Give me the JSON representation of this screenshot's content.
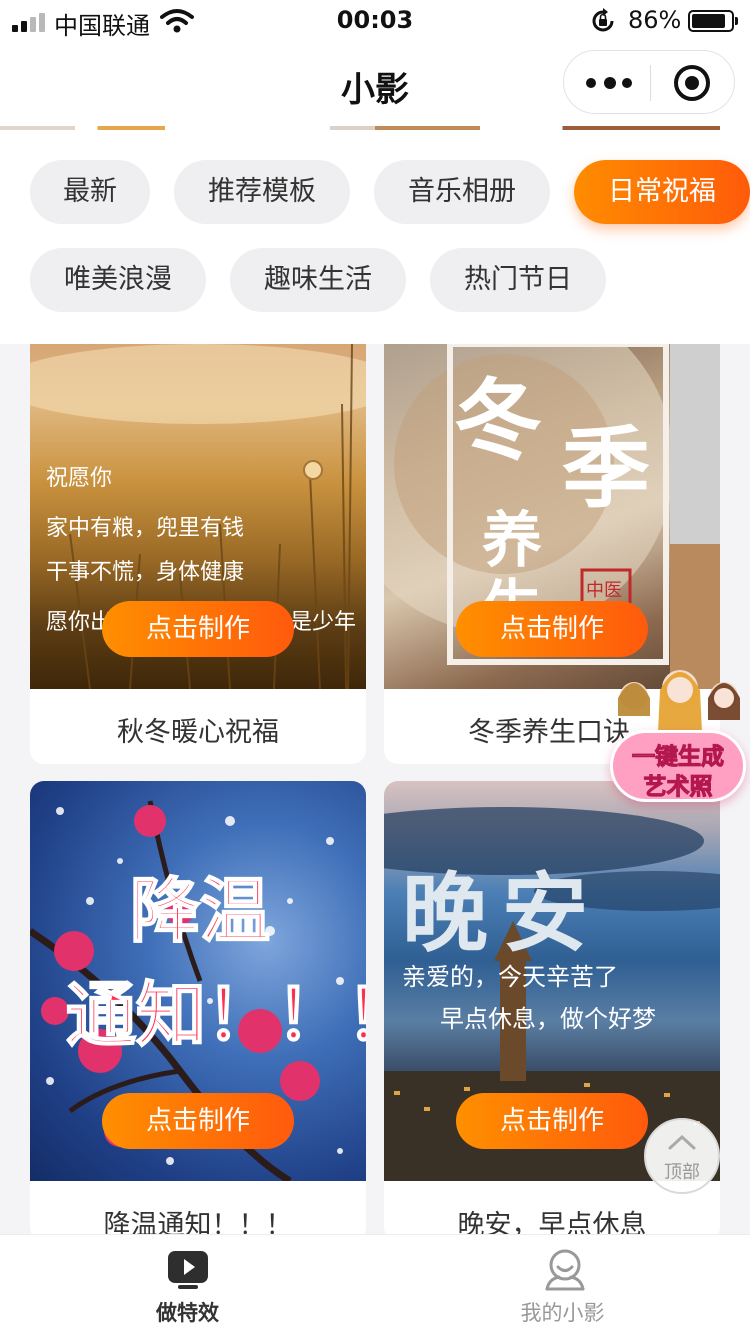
{
  "status_bar": {
    "carrier": "中国联通",
    "time": "00:03",
    "battery_percent": "86%",
    "battery_level": 0.86
  },
  "nav": {
    "title": "小影"
  },
  "categories": [
    {
      "label": "最新",
      "active": false
    },
    {
      "label": "推荐模板",
      "active": false
    },
    {
      "label": "音乐相册",
      "active": false
    },
    {
      "label": "日常祝福",
      "active": true
    },
    {
      "label": "唯美浪漫",
      "active": false
    },
    {
      "label": "趣味生活",
      "active": false
    },
    {
      "label": "热门节日",
      "active": false
    }
  ],
  "cards": [
    {
      "title": "秋冬暖心祝福",
      "button": "点击制作",
      "overlay_lines": [
        "祝愿你",
        "家中有粮，兜里有钱",
        "干事不慌，身体健康",
        "愿你出",
        "是少年"
      ]
    },
    {
      "title": "冬季养生口诀",
      "button": "点击制作",
      "overlay_lines": [
        "冬",
        "季",
        "养",
        "生",
        "中医"
      ]
    },
    {
      "title": "降温通知！！！",
      "button": "点击制作",
      "overlay_lines": [
        "降温",
        "通知！！！"
      ]
    },
    {
      "title": "晚安，早点休息",
      "button": "点击制作",
      "overlay_lines": [
        "晚安",
        "亲爱的，今天辛苦了",
        "早点休息，做个好梦"
      ]
    }
  ],
  "art_badge": {
    "line1": "一键生成",
    "line2": "艺术照"
  },
  "back_to_top": {
    "label": "顶部"
  },
  "tabbar": [
    {
      "label": "做特效",
      "active": true,
      "icon": "play-icon"
    },
    {
      "label": "我的小影",
      "active": false,
      "icon": "user-icon"
    }
  ],
  "colors": {
    "accent": "#ff6a00",
    "active_tab": "#333333",
    "inactive_tab": "#999999"
  }
}
